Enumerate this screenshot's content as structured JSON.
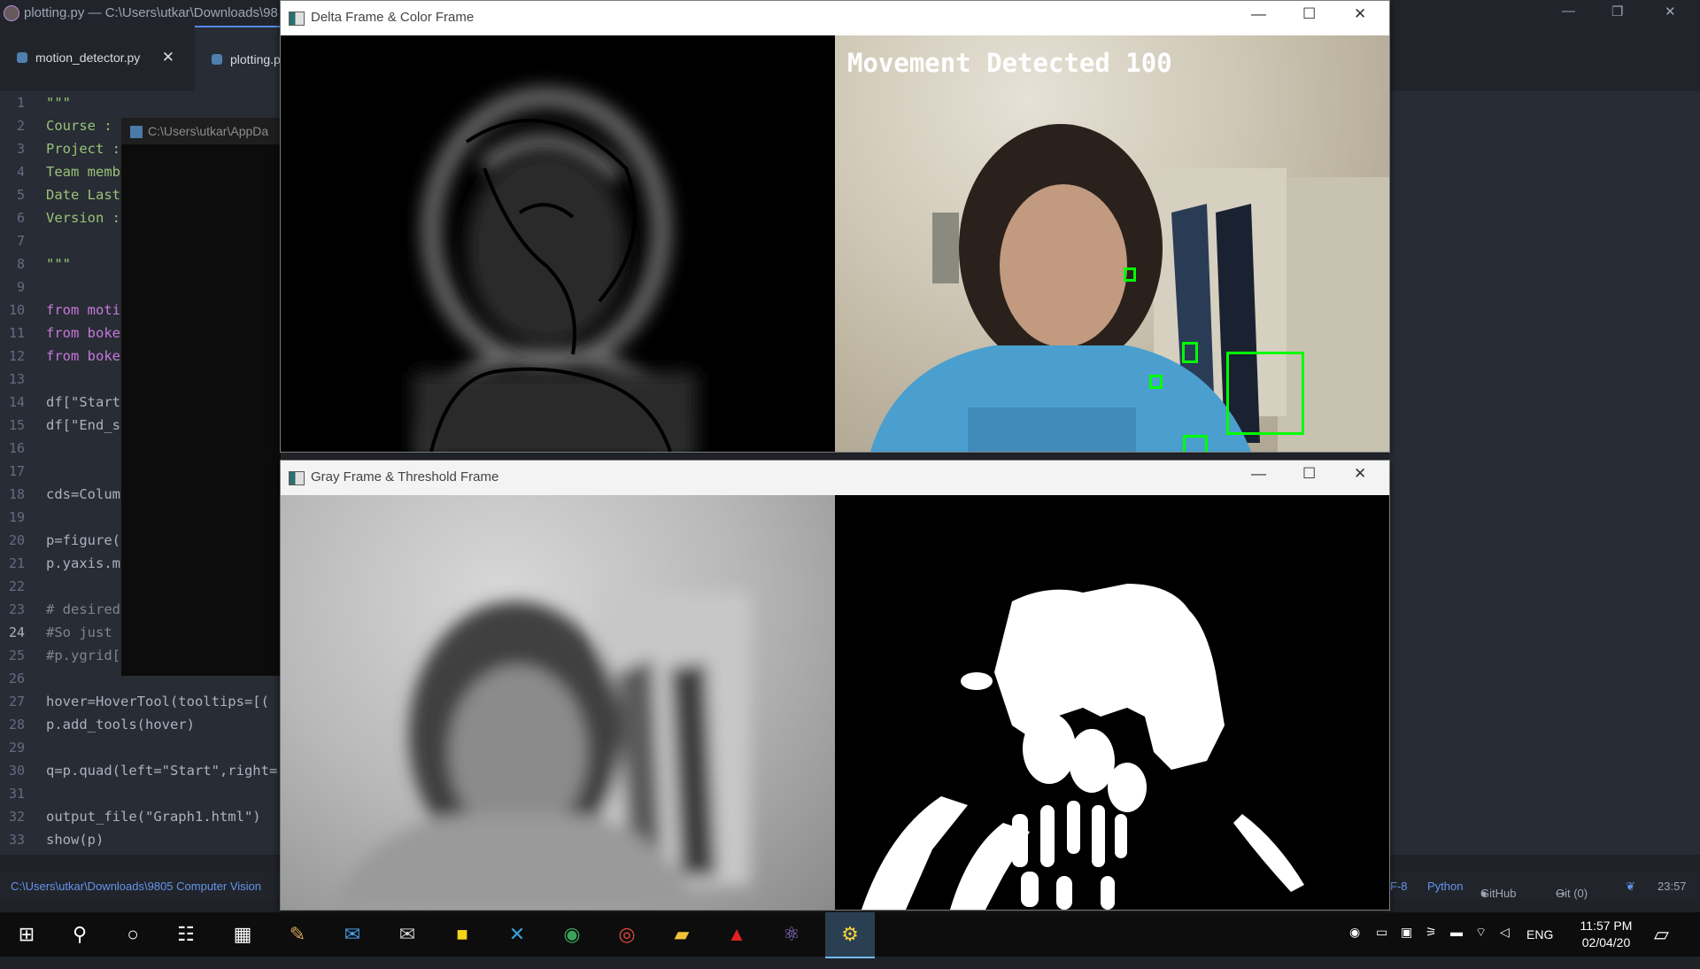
{
  "atom": {
    "title": "plotting.py — C:\\Users\\utkar\\Downloads\\98",
    "tabs": [
      {
        "label": "motion_detector.py",
        "close": "✕"
      },
      {
        "label": "plotting.p"
      }
    ],
    "line_numbers": [
      "1",
      "2",
      "3",
      "4",
      "5",
      "6",
      "7",
      "8",
      "9",
      "10",
      "11",
      "12",
      "13",
      "14",
      "15",
      "16",
      "17",
      "18",
      "19",
      "20",
      "21",
      "22",
      "23",
      "24",
      "25",
      "26",
      "27",
      "28",
      "29",
      "30",
      "31",
      "32",
      "33"
    ],
    "code_lines": [
      "\"\"\"",
      "Course :",
      "Project :",
      "Team memb",
      "Date Last",
      "Version :",
      "",
      "\"\"\"",
      "",
      "from moti",
      "from boke",
      "from boke",
      "",
      "df[\"Start",
      "df[\"End_s",
      "",
      "",
      "cds=Colum",
      "",
      "p=figure(",
      "p.yaxis.m",
      "",
      "# desired",
      "#So just",
      "#p.ygrid[",
      "",
      "hover=HoverTool(tooltips=[(",
      "p.add_tools(hover)",
      "",
      "q=p.quad(left=\"Start\",right=",
      "",
      "output_file(\"Graph1.html\")",
      "show(p)"
    ],
    "console_title": "C:\\Users\\utkar\\AppDa",
    "status": {
      "path": "C:\\Users\\utkar\\Downloads\\9805 Computer Vision",
      "encoding": "F-8",
      "grammar": "Python",
      "github": "GitHub",
      "git": "Git (0)",
      "time": "23:57"
    }
  },
  "windows": {
    "delta_color": {
      "title": "Delta Frame & Color Frame",
      "overlay_text": "Movement Detected 100"
    },
    "gray_threshold": {
      "title": "Gray Frame & Threshold Frame"
    },
    "controls": {
      "minimize": "—",
      "maximize": "☐",
      "close": "✕"
    }
  },
  "taskbar": {
    "items": [
      "windows-icon",
      "search-icon",
      "cortana-icon",
      "task-view-icon",
      "calculator-icon",
      "paint-icon",
      "outlook-icon",
      "email-icon",
      "sticky-notes-icon",
      "editor-app-icon",
      "paint3d-icon",
      "chrome-icon",
      "file-explorer-icon",
      "acrobat-icon",
      "atom-icon",
      "python-icon"
    ],
    "language": "ENG",
    "time": "11:57 PM",
    "date": "02/04/20"
  }
}
